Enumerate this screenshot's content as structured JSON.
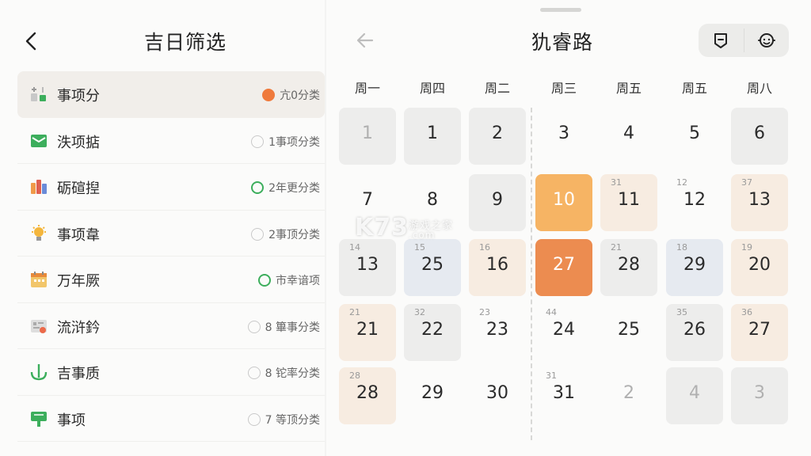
{
  "left": {
    "title": "吉日筛选",
    "items": [
      {
        "label": "事项分",
        "meta": "亢0分类",
        "dot": "orange",
        "icon": "blocks-icon",
        "active": true
      },
      {
        "label": "泆项掂",
        "meta": "1事项分类",
        "dot": "gray",
        "icon": "envelope-icon",
        "active": false
      },
      {
        "label": "砺碹揑",
        "meta": "2年更分类",
        "dot": "green",
        "icon": "books-icon",
        "active": false
      },
      {
        "label": "事项韋",
        "meta": "2事顶分类",
        "dot": "gray",
        "icon": "lamp-icon",
        "active": false
      },
      {
        "label": "万年厥",
        "meta": "市幸谙项",
        "dot": "green",
        "icon": "calendar-icon",
        "active": false
      },
      {
        "label": "流浒鈐",
        "meta": "8 篳事分类",
        "dot": "gray",
        "icon": "card-icon",
        "active": false
      },
      {
        "label": "吉事质",
        "meta": "8 铊率分类",
        "dot": "gray",
        "icon": "anchor-icon",
        "active": false
      },
      {
        "label": "事项",
        "meta": "7 等顶分类",
        "dot": "gray",
        "icon": "sign-icon",
        "active": false
      }
    ]
  },
  "right": {
    "title": "犰睿路",
    "weekdays": [
      "周一",
      "周四",
      "周二",
      "周三",
      "周五",
      "周五",
      "周八"
    ],
    "rows": [
      [
        {
          "n": "1",
          "bg": "gray",
          "faded": true
        },
        {
          "n": "1",
          "bg": "gray"
        },
        {
          "n": "2",
          "bg": "gray"
        },
        {
          "n": "3",
          "bg": "none"
        },
        {
          "n": "4",
          "bg": "none"
        },
        {
          "n": "5",
          "bg": "none"
        },
        {
          "n": "6",
          "bg": "gray"
        }
      ],
      [
        {
          "n": "7",
          "bg": "none"
        },
        {
          "n": "8",
          "bg": "none"
        },
        {
          "n": "9",
          "bg": "gray"
        },
        {
          "n": "10",
          "bg": "orange-light"
        },
        {
          "n": "11",
          "sub": "31",
          "bg": "peach"
        },
        {
          "n": "12",
          "sub": "12",
          "bg": "none"
        },
        {
          "n": "13",
          "sub": "37",
          "bg": "peach"
        }
      ],
      [
        {
          "n": "13",
          "sub": "14",
          "bg": "gray"
        },
        {
          "n": "25",
          "sub": "15",
          "bg": "blue"
        },
        {
          "n": "16",
          "sub": "16",
          "bg": "peach"
        },
        {
          "n": "27",
          "bg": "orange"
        },
        {
          "n": "28",
          "sub": "21",
          "bg": "gray"
        },
        {
          "n": "29",
          "sub": "18",
          "bg": "blue"
        },
        {
          "n": "20",
          "sub": "19",
          "bg": "peach"
        }
      ],
      [
        {
          "n": "21",
          "sub": "21",
          "bg": "peach"
        },
        {
          "n": "22",
          "sub": "32",
          "bg": "gray"
        },
        {
          "n": "23",
          "sub": "23",
          "bg": "none"
        },
        {
          "n": "24",
          "sub": "44",
          "bg": "none"
        },
        {
          "n": "25",
          "bg": "none"
        },
        {
          "n": "26",
          "sub": "35",
          "bg": "gray"
        },
        {
          "n": "27",
          "sub": "36",
          "bg": "peach"
        }
      ],
      [
        {
          "n": "28",
          "sub": "28",
          "bg": "peach"
        },
        {
          "n": "29",
          "bg": "none"
        },
        {
          "n": "30",
          "bg": "none"
        },
        {
          "n": "31",
          "sub": "31",
          "bg": "none"
        },
        {
          "n": "2",
          "bg": "none",
          "faded": true
        },
        {
          "n": "4",
          "bg": "gray",
          "faded": true
        },
        {
          "n": "3",
          "bg": "gray",
          "faded": true
        }
      ]
    ]
  },
  "watermark": {
    "main": "K73",
    "sub": "游戏之家",
    "domain": ".com"
  },
  "colors": {
    "accent": "#ec8c50",
    "accent_light": "#f6b464",
    "green": "#3cae5c"
  }
}
